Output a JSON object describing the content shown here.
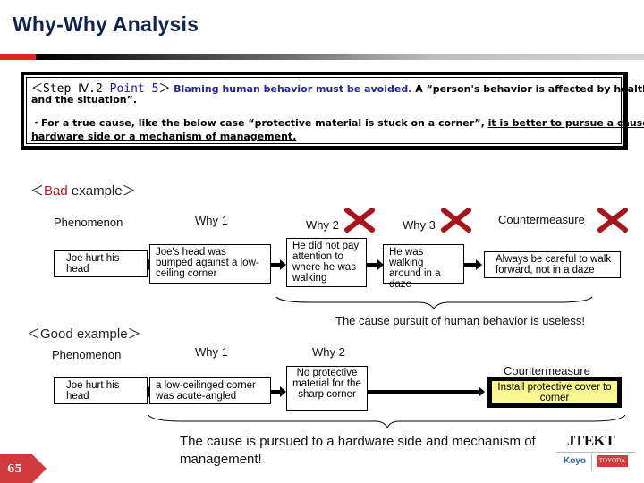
{
  "header": {
    "title": "Why-Why Analysis"
  },
  "rule_box": {
    "step_prefix": "＜Step Ⅳ.2 ",
    "step_point": "Point 5",
    "step_suffix": "＞",
    "blaming": "Blaming human behavior must be avoided.",
    "affected": " A “person's behavior is affected by health",
    "affected_cont": "and the situation”.",
    "bullet_plain": "・For a true cause, like the below case “protective material is stuck on a corner”, ",
    "bullet_under_1": "it is better to pursue a cause to a",
    "bullet_under_2": "hardware side or a mechanism of management."
  },
  "bad_example": {
    "heading_open": "＜",
    "heading_word": "Bad",
    "heading_rest": " example＞",
    "columns": [
      "Phenomenon",
      "Why 1",
      "Why 2",
      "Why 3",
      "Countermeasure"
    ],
    "boxes": [
      "Joe hurt his head",
      "Joe's head was bumped against a low-ceiling corner",
      "He did not pay attention to where he was walking",
      "He was walking around in a daze",
      "Always be careful to walk forward, not in a daze"
    ],
    "rejected_icon": "x-mark-icon",
    "note": "The cause pursuit of human behavior is useless!"
  },
  "good_example": {
    "heading": "＜Good example＞",
    "columns": [
      "Phenomenon",
      "Why 1",
      "Why 2",
      "Countermeasure"
    ],
    "boxes": [
      "Joe hurt his head",
      "a low-ceilinged corner was acute-angled",
      "No protective material for the sharp corner",
      "Install protective cover to corner"
    ],
    "note": "The cause is pursued to a hardware side and mechanism of management!"
  },
  "footer": {
    "page_number": "65",
    "logo_main": "JTEKT",
    "logo_sub_1": "Koyo",
    "logo_sub_2": "TOYODA"
  },
  "colors": {
    "title": "#0f2450",
    "accent_red": "#e0281e",
    "x_mark": "#a8141c",
    "highlight": "#fbf694",
    "page_badge": "#d03a3c"
  }
}
